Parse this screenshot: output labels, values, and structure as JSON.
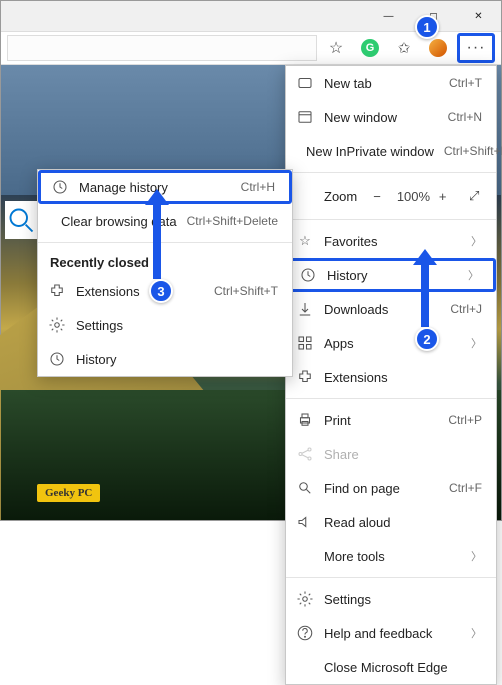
{
  "window": {
    "minimize": "—",
    "maximize": "◻",
    "close": "✕"
  },
  "toolbar": {
    "url": "",
    "star": "☆",
    "fav_plus": "⊕",
    "more": "···"
  },
  "main_menu": {
    "new_tab": "New tab",
    "new_tab_sc": "Ctrl+T",
    "new_window": "New window",
    "new_window_sc": "Ctrl+N",
    "inprivate": "New InPrivate window",
    "inprivate_sc": "Ctrl+Shift+N",
    "zoom": "Zoom",
    "zoom_val": "100%",
    "favorites": "Favorites",
    "history": "History",
    "downloads": "Downloads",
    "downloads_sc": "Ctrl+J",
    "apps": "Apps",
    "extensions": "Extensions",
    "print": "Print",
    "print_sc": "Ctrl+P",
    "share": "Share",
    "find": "Find on page",
    "find_sc": "Ctrl+F",
    "read_aloud": "Read aloud",
    "more_tools": "More tools",
    "settings": "Settings",
    "help": "Help and feedback",
    "close_edge": "Close Microsoft Edge"
  },
  "sub_menu": {
    "manage": "Manage history",
    "manage_sc": "Ctrl+H",
    "clear": "Clear browsing data",
    "clear_sc": "Ctrl+Shift+Delete",
    "recently": "Recently closed",
    "extensions": "Extensions",
    "extensions_sc": "Ctrl+Shift+T",
    "settings": "Settings",
    "history": "History"
  },
  "badges": {
    "b1": "1",
    "b2": "2",
    "b3": "3"
  },
  "watermark": "Geeky PC"
}
